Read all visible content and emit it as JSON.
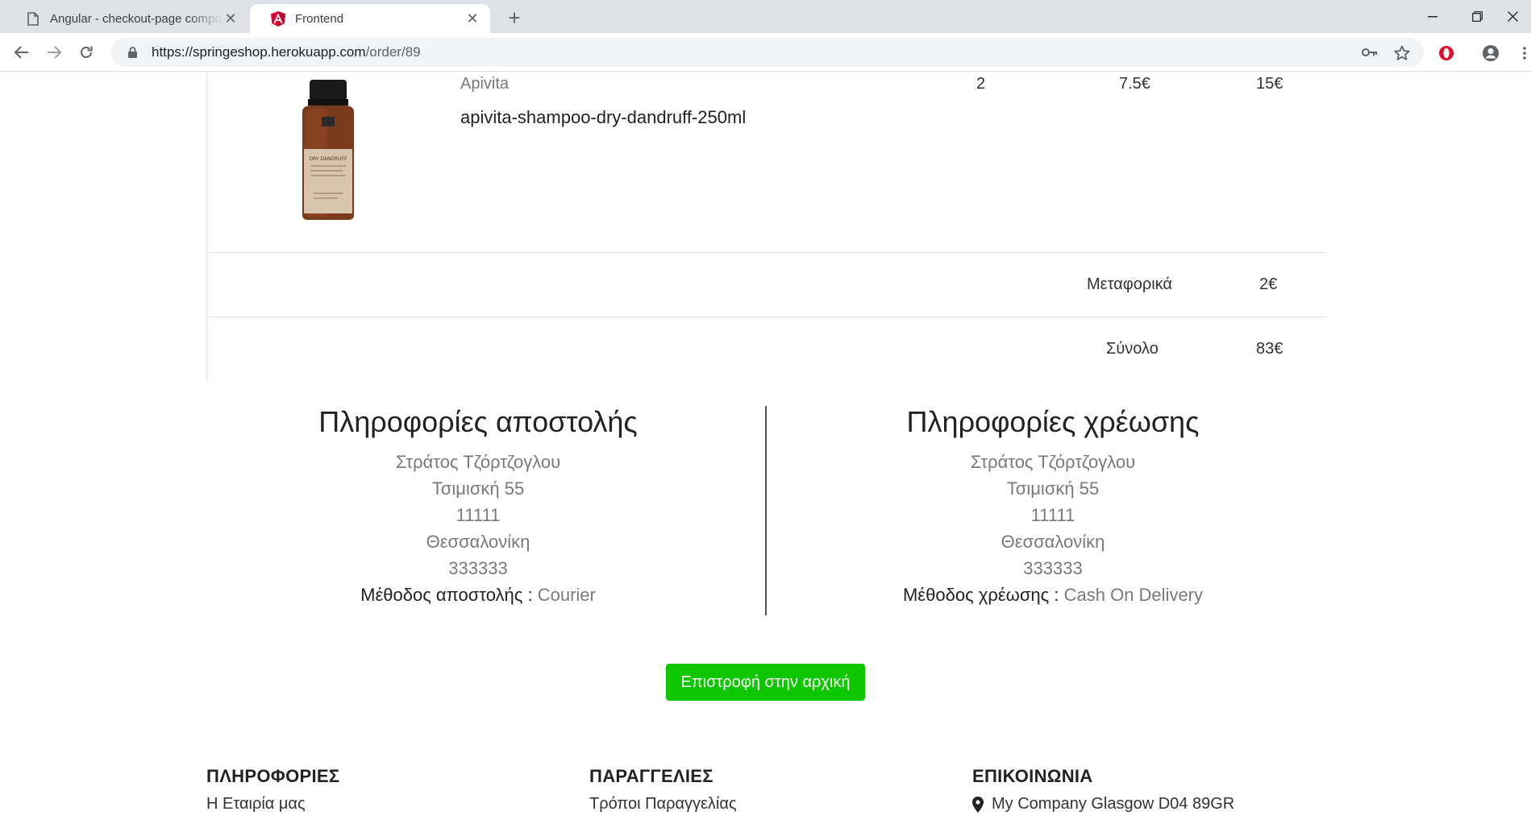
{
  "browser": {
    "tabs": [
      {
        "title": "Angular - checkout-page compo",
        "active": false
      },
      {
        "title": "Frontend",
        "active": true
      }
    ],
    "url_host": "https://springeshop.herokuapp.com",
    "url_path": "/order/89"
  },
  "order": {
    "item": {
      "brand": "Apivita",
      "name": "apivita-shampoo-dry-dandruff-250ml",
      "quantity": "2",
      "unit_price": "7.5€",
      "line_total": "15€",
      "image_label": "DRY DANDRUFF"
    },
    "shipping_cost_label": "Μεταφορικά",
    "shipping_cost": "2€",
    "total_label": "Σύνολο",
    "total": "83€"
  },
  "shipping_info": {
    "heading": "Πληροφορίες αποστολής",
    "name": "Στράτος Τζόρτζογλου",
    "street": "Τσιμισκή 55",
    "postcode": "11111",
    "city": "Θεσσαλονίκη",
    "phone": "333333",
    "method_label": "Μέθοδος αποστολής :",
    "method": "Courier"
  },
  "billing_info": {
    "heading": "Πληροφορίες χρέωσης",
    "name": "Στράτος Τζόρτζογλου",
    "street": "Τσιμισκή 55",
    "postcode": "11111",
    "city": "Θεσσαλονίκη",
    "phone": "333333",
    "method_label": "Μέθοδος χρέωσης :",
    "method": "Cash On Delivery"
  },
  "home_button_label": "Επιστροφή στην αρχική",
  "footer": {
    "info": {
      "heading": "ΠΛΗΡΟΦΟΡΙΕΣ",
      "link": "Η Εταιρία μας"
    },
    "orders": {
      "heading": "ΠΑΡΑΓΓΕΛΙΕΣ",
      "link": "Τρόποι Παραγγελίας"
    },
    "contact": {
      "heading": "ΕΠΙΚΟΙΝΩΝΙΑ",
      "address": "My Company Glasgow D04 89GR"
    }
  },
  "colors": {
    "accent_green": "#0ec700",
    "tabstrip": "#dee1e6",
    "angular_red": "#dd0031"
  },
  "icons": [
    "document-icon",
    "angular-icon",
    "close-icon",
    "plus-icon",
    "minimize-icon",
    "restore-icon",
    "close-window-icon",
    "back-icon",
    "forward-icon",
    "reload-icon",
    "lock-icon",
    "key-icon",
    "star-icon",
    "opera-icon",
    "account-icon",
    "more-icon",
    "map-marker-icon"
  ]
}
